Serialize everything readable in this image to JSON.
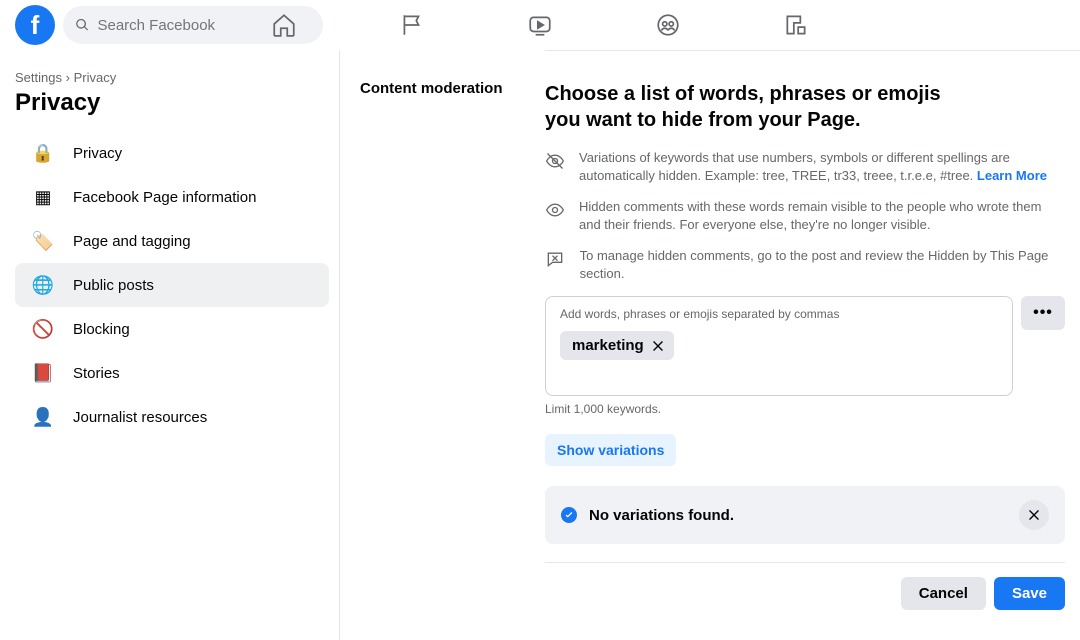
{
  "header": {
    "search_placeholder": "Search Facebook"
  },
  "breadcrumb": {
    "root": "Settings",
    "sep": "›",
    "leaf": "Privacy"
  },
  "page_title": "Privacy",
  "sidebar": {
    "items": [
      {
        "label": "Privacy",
        "icon": "🔒"
      },
      {
        "label": "Facebook Page information",
        "icon": "▦"
      },
      {
        "label": "Page and tagging",
        "icon": "🏷️"
      },
      {
        "label": "Public posts",
        "icon": "🌐"
      },
      {
        "label": "Blocking",
        "icon": "🚫"
      },
      {
        "label": "Stories",
        "icon": "📕"
      },
      {
        "label": "Journalist resources",
        "icon": "👤"
      }
    ],
    "active_index": 3
  },
  "section": {
    "label": "Content moderation",
    "heading": "Choose a list of words, phrases or emojis you want to hide from your Page.",
    "info": [
      {
        "icon": "eye-off",
        "text": "Variations of keywords that use numbers, symbols or different spellings are automatically hidden. Example: tree, TREE, tr33, treee, t.r.e.e, #tree. ",
        "link": "Learn More"
      },
      {
        "icon": "eye",
        "text": "Hidden comments with these words remain visible to the people who wrote them and their friends. For everyone else, they're no longer visible."
      },
      {
        "icon": "comment-x",
        "text": "To manage hidden comments, go to the post and review the Hidden by This Page section."
      }
    ],
    "chip_label": "Add words, phrases or emojis separated by commas",
    "chip_value": "marketing",
    "overflow_label": "•••",
    "limit_text": "Limit 1,000 keywords.",
    "show_variations": "Show variations",
    "banner_text": "No variations found.",
    "cancel": "Cancel",
    "save": "Save"
  }
}
